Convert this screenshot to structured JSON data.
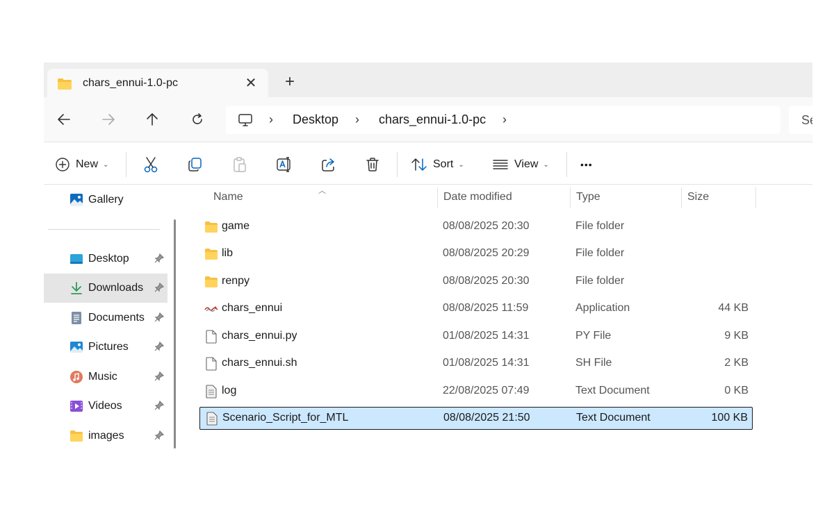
{
  "window": {
    "accent": "#0067c0",
    "selection_color": "#cce8ff"
  },
  "tab": {
    "title": "chars_ennui-1.0-pc",
    "close_label": "✕",
    "new_tab_label": "+"
  },
  "address": {
    "breadcrumbs": [
      "Desktop",
      "chars_ennui-1.0-pc"
    ],
    "separator": "›",
    "search_placeholder": "Se"
  },
  "toolbar": {
    "new_label": "New",
    "sort_label": "Sort",
    "view_label": "View",
    "more_label": "•••",
    "chevron": "⌄"
  },
  "sidebar": {
    "items": [
      {
        "label": "Gallery",
        "icon": "gallery-icon",
        "pinned": false
      },
      {
        "label": "Desktop",
        "icon": "desktop-icon",
        "pinned": true
      },
      {
        "label": "Downloads",
        "icon": "downloads-icon",
        "pinned": true,
        "selected": true
      },
      {
        "label": "Documents",
        "icon": "documents-icon",
        "pinned": true
      },
      {
        "label": "Pictures",
        "icon": "pictures-icon",
        "pinned": true
      },
      {
        "label": "Music",
        "icon": "music-icon",
        "pinned": true
      },
      {
        "label": "Videos",
        "icon": "videos-icon",
        "pinned": true
      },
      {
        "label": "images",
        "icon": "folder-icon",
        "pinned": true
      }
    ]
  },
  "columns": {
    "name": "Name",
    "date": "Date modified",
    "type": "Type",
    "size": "Size"
  },
  "files": [
    {
      "name": "game",
      "date": "08/08/2025 20:30",
      "type": "File folder",
      "size": "",
      "icon": "folder-icon"
    },
    {
      "name": "lib",
      "date": "08/08/2025 20:29",
      "type": "File folder",
      "size": "",
      "icon": "folder-icon"
    },
    {
      "name": "renpy",
      "date": "08/08/2025 20:30",
      "type": "File folder",
      "size": "",
      "icon": "folder-icon"
    },
    {
      "name": "chars_ennui",
      "date": "08/08/2025 11:59",
      "type": "Application",
      "size": "44 KB",
      "icon": "application-icon"
    },
    {
      "name": "chars_ennui.py",
      "date": "01/08/2025 14:31",
      "type": "PY File",
      "size": "9 KB",
      "icon": "blank-file-icon"
    },
    {
      "name": "chars_ennui.sh",
      "date": "01/08/2025 14:31",
      "type": "SH File",
      "size": "2 KB",
      "icon": "blank-file-icon"
    },
    {
      "name": "log",
      "date": "22/08/2025 07:49",
      "type": "Text Document",
      "size": "0 KB",
      "icon": "text-file-icon"
    },
    {
      "name": "Scenario_Script_for_MTL",
      "date": "08/08/2025 21:50",
      "type": "Text Document",
      "size": "100 KB",
      "icon": "text-file-icon",
      "selected": true
    }
  ]
}
